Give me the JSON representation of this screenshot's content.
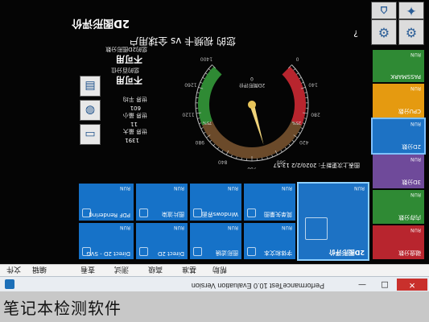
{
  "window": {
    "title": "PerformanceTest 10.0 Evaluation Version",
    "btn_min": "—",
    "btn_max": "□",
    "btn_close": "✕"
  },
  "menu": {
    "items": [
      "文件",
      "编辑",
      "查看",
      "测试",
      "高级",
      "基准",
      "帮助"
    ]
  },
  "header": {
    "title": "2D图形评价",
    "subtitle": "您的 视频卡 vs 全球用户"
  },
  "stats": {
    "score_label": "您的2D图形分数",
    "score_value": "不可用",
    "percent_label": "您的百分位",
    "percent_value": "不可用",
    "world_avg_label": "世界 平均",
    "world_avg_value": "601",
    "world_min_label": "世界 最小",
    "world_min_value": "11",
    "world_max_label": "世界 最大",
    "world_max_value": "1391"
  },
  "gauge": {
    "ticks": [
      "0",
      "140",
      "280",
      "420",
      "560",
      "700",
      "840",
      "980",
      "1120",
      "1260",
      "1400"
    ],
    "pct_low": "25%",
    "pct_high": "75%",
    "center_label": "2D图形评价",
    "center_value": "0",
    "updated": "图表上次更新于: 2020/2/2 13:57"
  },
  "tiles": {
    "row_top": [
      {
        "label": "PDF Rendering",
        "run": "RUN"
      },
      {
        "label": "图片渲染",
        "run": "RUN"
      },
      {
        "label": "Windows界面",
        "run": "RUN"
      },
      {
        "label": "简单矢量图",
        "run": "RUN"
      }
    ],
    "row_bottom": [
      {
        "label": "Direct 2D - SVG",
        "run": "RUN"
      },
      {
        "label": "Direct 2D",
        "run": "RUN"
      },
      {
        "label": "图形滤镜",
        "run": "RUN"
      },
      {
        "label": "字体和文本",
        "run": "RUN"
      }
    ],
    "big": {
      "label": "2D图形评价",
      "run": "RUN"
    }
  },
  "right_column": [
    {
      "label": "PASSMARK",
      "run": "RUN",
      "color": "#2f8a34"
    },
    {
      "label": "CPU分数",
      "run": "RUN",
      "color": "#e59a10"
    },
    {
      "label": "2D分数",
      "run": "RUN",
      "color": "#1d72c4"
    },
    {
      "label": "3D分数",
      "run": "RUN",
      "color": "#6f4a9a"
    },
    {
      "label": "内存分数",
      "run": "RUN",
      "color": "#2f8a34"
    },
    {
      "label": "磁盘分数",
      "run": "RUN",
      "color": "#b8252e"
    }
  ],
  "caption": "笔记本检测软件"
}
